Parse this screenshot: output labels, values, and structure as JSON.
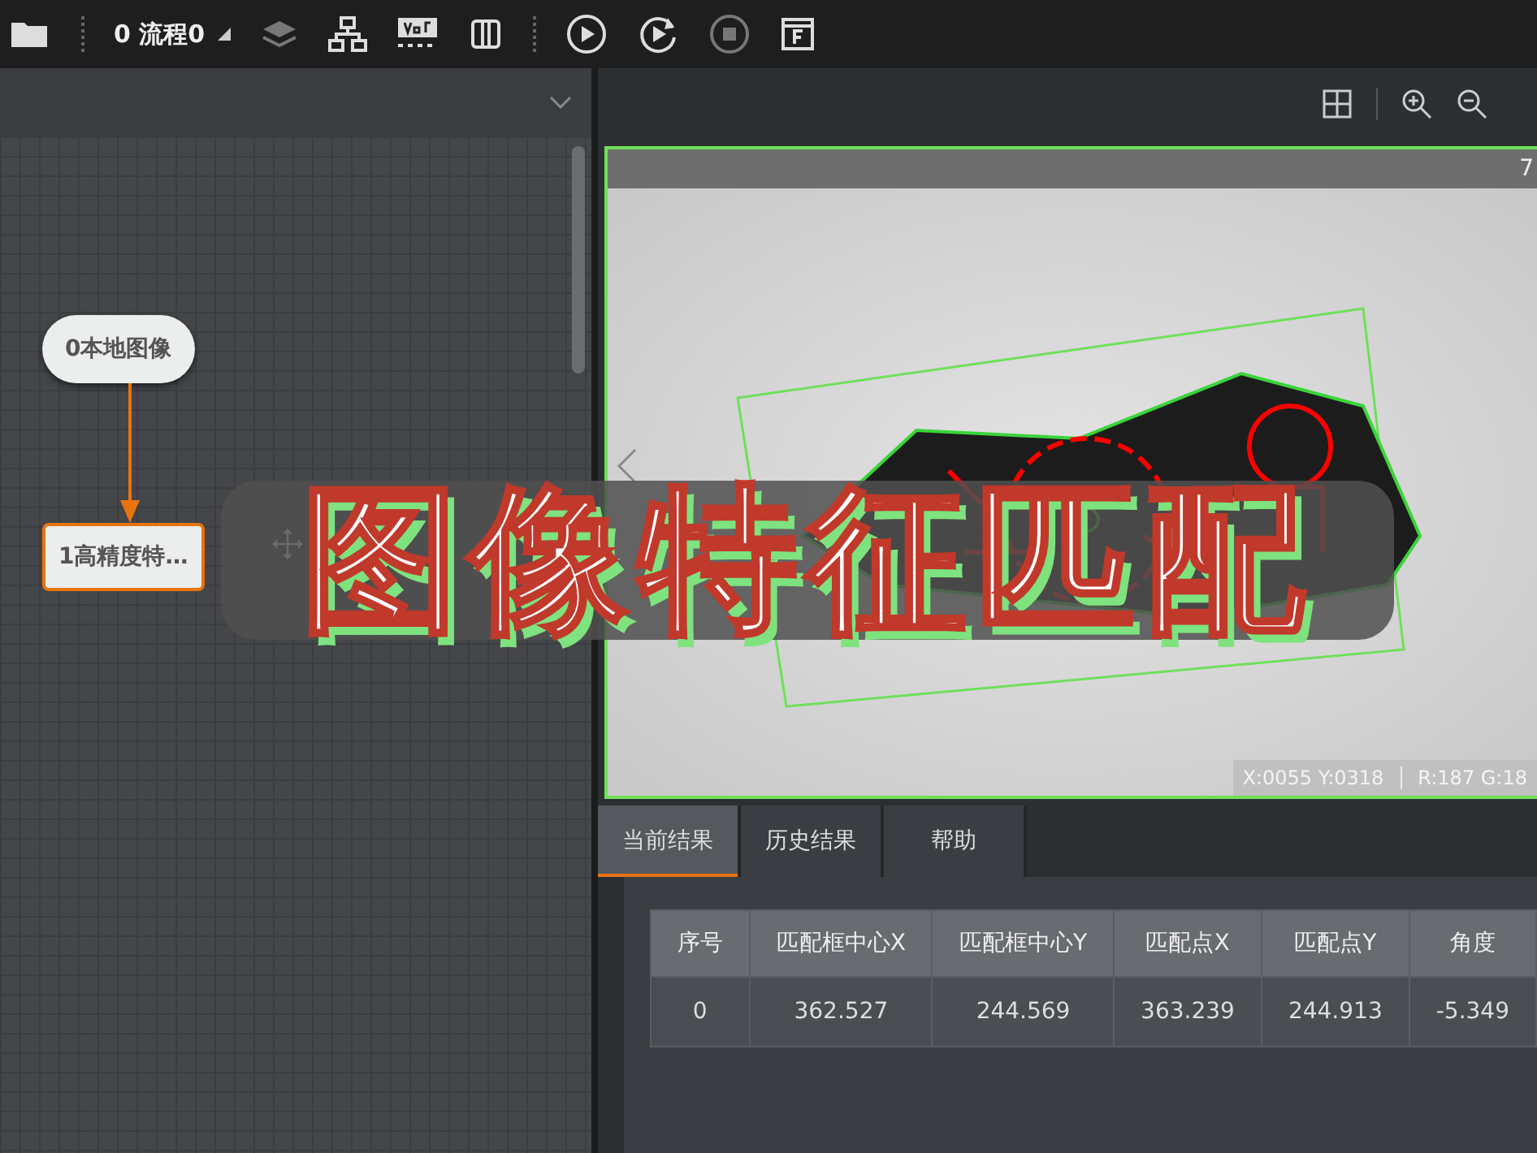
{
  "toolbar": {
    "flow_label": "0 流程0"
  },
  "canvas": {
    "nodes": [
      {
        "label": "0本地图像",
        "kind": "start",
        "selected": false
      },
      {
        "label": "1高精度特…",
        "kind": "tool",
        "selected": true
      }
    ]
  },
  "viewer": {
    "zoom_text": "7",
    "coords": "X:0055  Y:0318",
    "pixel": "R:187  G:18"
  },
  "result_tabs": [
    {
      "label": "当前结果",
      "selected": true
    },
    {
      "label": "历史结果",
      "selected": false
    },
    {
      "label": "帮助",
      "selected": false
    }
  ],
  "table": {
    "columns": [
      "序号",
      "匹配框中心X",
      "匹配框中心Y",
      "匹配点X",
      "匹配点Y",
      "角度"
    ],
    "rows": [
      [
        "0",
        "362.527",
        "244.569",
        "363.239",
        "244.913",
        "-5.349"
      ]
    ]
  },
  "caption": "图像特征匹配"
}
